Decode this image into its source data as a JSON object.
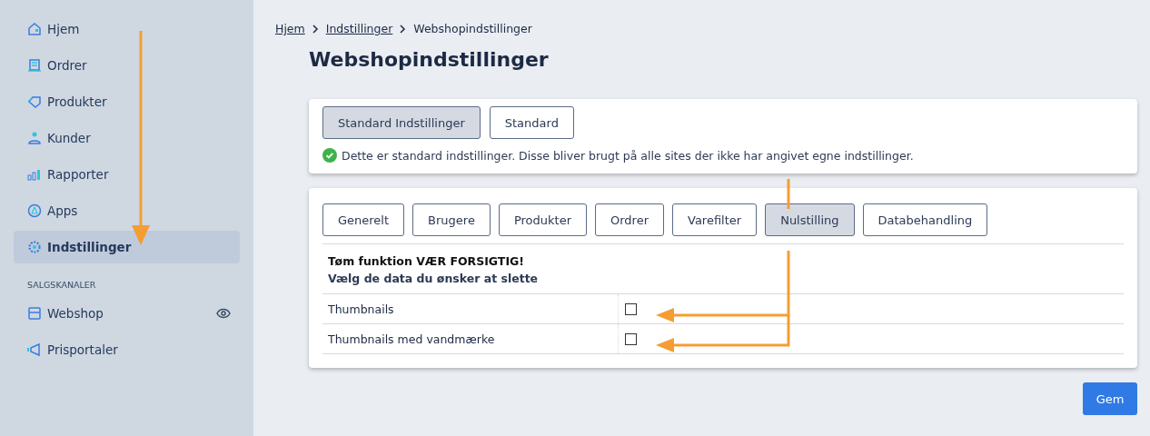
{
  "sidebar": {
    "items": [
      {
        "label": "Hjem",
        "selected": false
      },
      {
        "label": "Ordrer",
        "selected": false
      },
      {
        "label": "Produkter",
        "selected": false
      },
      {
        "label": "Kunder",
        "selected": false
      },
      {
        "label": "Rapporter",
        "selected": false
      },
      {
        "label": "Apps",
        "selected": false
      },
      {
        "label": "Indstillinger",
        "selected": true
      }
    ],
    "section_title": "SALGSKANALER",
    "channels": [
      {
        "label": "Webshop"
      },
      {
        "label": "Prisportaler"
      }
    ]
  },
  "breadcrumb": [
    {
      "label": "Hjem",
      "kind": "link"
    },
    {
      "label": "Indstillinger",
      "kind": "link"
    },
    {
      "label": "Webshopindstillinger",
      "kind": "current"
    }
  ],
  "title": "Webshopindstillinger",
  "scope_tabs": [
    {
      "label": "Standard Indstillinger",
      "selected": true
    },
    {
      "label": "Standard",
      "selected": false
    }
  ],
  "notice": "Dette er standard indstillinger. Disse bliver brugt på alle sites der ikke har angivet egne indstillinger.",
  "tabs": [
    {
      "label": "Generelt",
      "selected": false
    },
    {
      "label": "Brugere",
      "selected": false
    },
    {
      "label": "Produkter",
      "selected": false
    },
    {
      "label": "Ordrer",
      "selected": false
    },
    {
      "label": "Varefilter",
      "selected": false
    },
    {
      "label": "Nulstilling",
      "selected": true
    },
    {
      "label": "Databehandling",
      "selected": false
    }
  ],
  "section": {
    "warning": "Tøm funktion VÆR FORSIGTIG!",
    "subtitle": "Vælg de data du ønsker at slette"
  },
  "rows": [
    {
      "label": "Thumbnails",
      "checked": false
    },
    {
      "label": "Thumbnails med vandmærke",
      "checked": false
    }
  ],
  "save_button": "Gem"
}
